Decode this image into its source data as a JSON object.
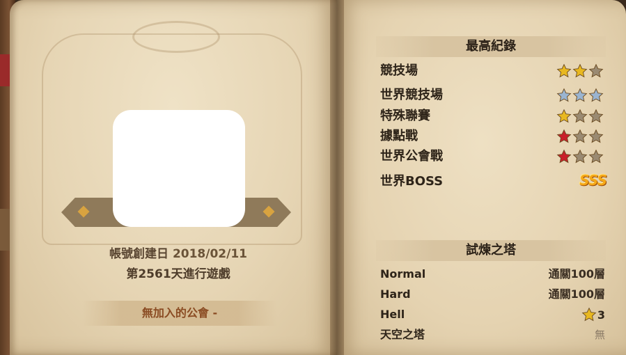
{
  "profile": {
    "created_label": "帳號創建日",
    "created_date": "2018/02/11",
    "days_played": "第2561天進行遊戲",
    "guild_label": "無加入的公會",
    "guild_value": "-"
  },
  "records": {
    "title": "最高紀錄",
    "rows": [
      {
        "label": "競技場",
        "stars": 2,
        "star_color": "#e8b820"
      },
      {
        "label": "世界競技場",
        "stars": 3,
        "star_color": "#9ab4d0"
      },
      {
        "label": "特殊聯賽",
        "stars": 1,
        "star_color": "#e8b820"
      },
      {
        "label": "據點戰",
        "stars": 1,
        "star_color": "#c8202a"
      },
      {
        "label": "世界公會戰",
        "stars": 1,
        "star_color": "#c8202a"
      },
      {
        "label": "世界BOSS",
        "rank": "SSS"
      }
    ]
  },
  "tower": {
    "title": "試煉之塔",
    "rows": [
      {
        "label": "Normal",
        "value": "通關100層"
      },
      {
        "label": "Hard",
        "value": "通關100層"
      },
      {
        "label": "Hell",
        "value": "3",
        "icon": "star-icon"
      },
      {
        "label": "天空之塔",
        "value": "無"
      }
    ]
  },
  "colors": {
    "star_empty": "#9a8a72",
    "guild_text": "#8a4b22",
    "rank_gold": "#f5a818"
  }
}
